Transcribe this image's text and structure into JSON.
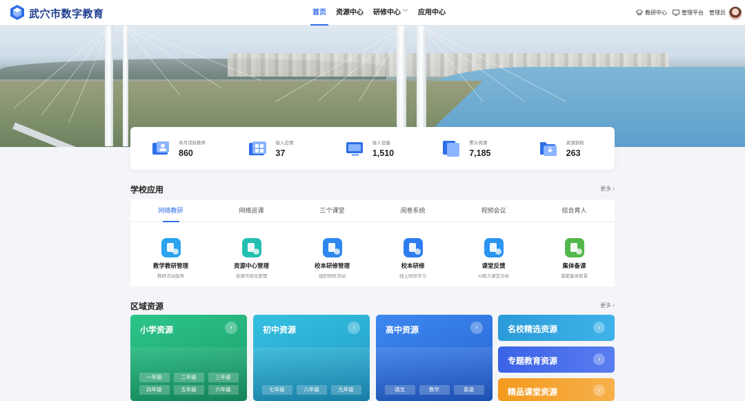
{
  "header": {
    "brand": "武穴市数字教育",
    "nav": [
      {
        "label": "首页",
        "active": true
      },
      {
        "label": "资源中心"
      },
      {
        "label": "研修中心",
        "dropdown": true
      },
      {
        "label": "应用中心"
      }
    ],
    "tools": {
      "teaching_center": "教研中心",
      "management_platform": "管理平台",
      "user_name": "管理员"
    },
    "icons": {
      "teaching_center": "graduation-cap-icon",
      "management_platform": "monitor-icon",
      "dropdown": "chevron-down-icon"
    }
  },
  "stats": [
    {
      "label": "本月活跃教师",
      "value": "860",
      "icon": "teacher-icon"
    },
    {
      "label": "接入应用",
      "value": "37",
      "icon": "apps-grid-icon"
    },
    {
      "label": "接入设备",
      "value": "1,510",
      "icon": "device-monitor-icon"
    },
    {
      "label": "累计资源",
      "value": "7,185",
      "icon": "stacked-files-icon"
    },
    {
      "label": "资源获取",
      "value": "263",
      "icon": "folder-download-icon"
    }
  ],
  "school_apps": {
    "title": "学校应用",
    "more": "更多",
    "tabs": [
      "网络教研",
      "网络巡课",
      "三个课堂",
      "阅卷系统",
      "视频会议",
      "综合育人"
    ],
    "active_tab": 0,
    "items": [
      {
        "name": "教学教研管理",
        "desc": "教研活动指导",
        "color": "#2aa3f0"
      },
      {
        "name": "资源中心管理",
        "desc": "资源可视化管理",
        "color": "#21c0b0"
      },
      {
        "name": "校本研修管理",
        "desc": "组织研修活动",
        "color": "#2d86ef"
      },
      {
        "name": "校本研修",
        "desc": "线上研修学习",
        "color": "#2e7df0"
      },
      {
        "name": "课堂反馈",
        "desc": "AI助力课堂分析",
        "color": "#2a95f0"
      },
      {
        "name": "集体备课",
        "desc": "凝聚集体智慧",
        "color": "#52b84d"
      }
    ]
  },
  "regional": {
    "title": "区域资源",
    "more": "更多",
    "cards": [
      {
        "title": "小学资源",
        "color": "#22b37a",
        "grades": [
          "一年级",
          "二年级",
          "三年级",
          "四年级",
          "五年级",
          "六年级"
        ]
      },
      {
        "title": "初中资源",
        "color": "#2bb3d6",
        "grades": [
          "七年级",
          "八年级",
          "九年级"
        ]
      },
      {
        "title": "高中资源",
        "color": "#2f7be8",
        "grades": [
          "语文",
          "数学",
          "英语"
        ]
      }
    ],
    "side": [
      {
        "title": "名校精选资源",
        "color": "#2a9bd8"
      },
      {
        "title": "专题教育资源",
        "color": "#3a63e6"
      },
      {
        "title": "精品课堂资源",
        "color": "#f39a1e"
      }
    ]
  }
}
